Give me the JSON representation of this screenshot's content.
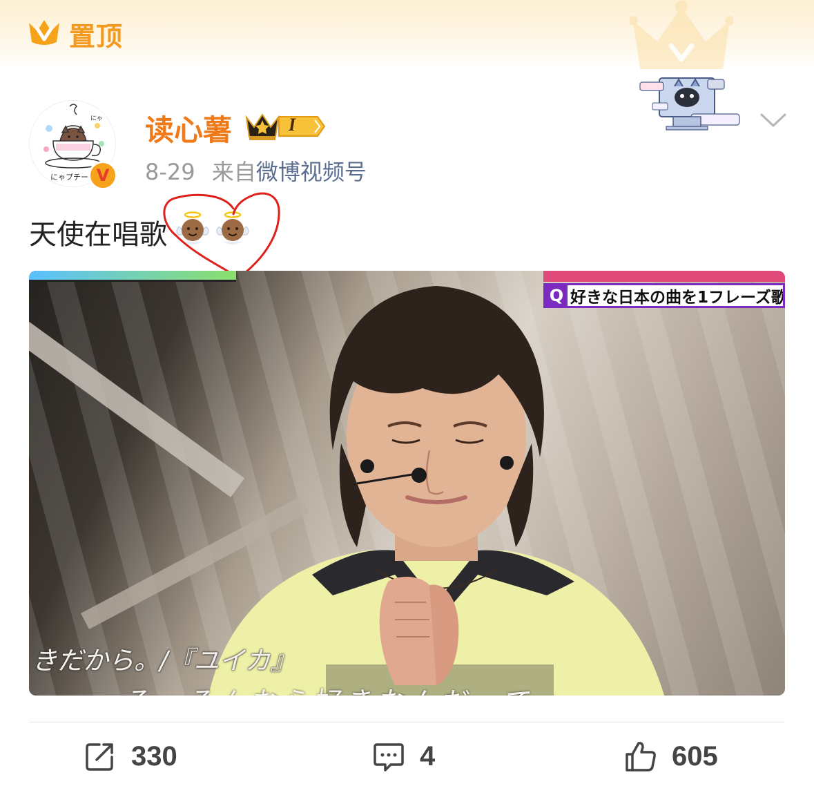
{
  "pinned": {
    "label": "置顶",
    "icon": "crown-v-icon"
  },
  "author": {
    "name": "读心薯",
    "member_level": "I",
    "verified_badge": "V",
    "avatar_caption": "にゃプチー",
    "avatar_tag": "にゃ"
  },
  "post": {
    "date": "8-29",
    "source_prefix": "来自",
    "source": "微博视频号",
    "text": "天使在唱歌",
    "emojis": [
      "baby-angel-icon",
      "baby-angel-icon"
    ]
  },
  "video": {
    "question_marker": "Q",
    "question_caption": "好きな日本の曲を1フレーズ歌",
    "subtitle_left": "きだから。/『ユイカ』",
    "subtitle_bottom": "そーそんなら好きなんだって"
  },
  "stats": {
    "reposts": "330",
    "comments": "4",
    "likes": "605"
  },
  "colors": {
    "username": "#f07a18",
    "pin_label": "#f39a1e",
    "source_link": "#5c6e8f",
    "annotation_red": "#e0201b",
    "question_purple": "#7b2bbf"
  }
}
